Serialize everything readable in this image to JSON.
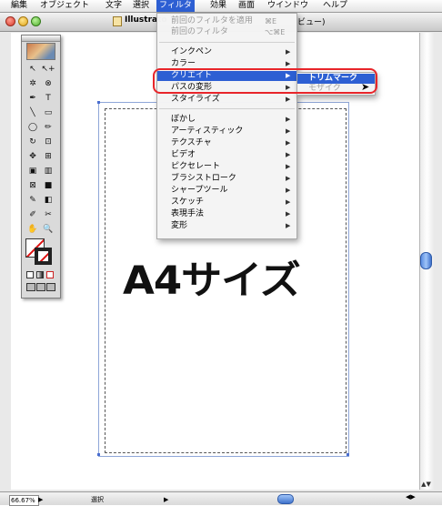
{
  "menubar": {
    "items": [
      "編集",
      "オブジェクト",
      "文字",
      "選択",
      "フィルタ",
      "効果",
      "画面",
      "ウインドウ",
      "ヘルプ"
    ],
    "active": "フィルタ"
  },
  "window": {
    "title": "Illustrato",
    "title_tail": "ビュー)"
  },
  "toolbox": {
    "tools": [
      "↖",
      "↖+",
      "✲",
      "⊗",
      "✒",
      "T",
      "╲",
      "▭",
      "◯",
      "✏",
      "↻",
      "⊡",
      "✥",
      "⊞",
      "▣",
      "▥",
      "⊠",
      "■",
      "✎",
      "◧",
      "✐",
      "✂",
      "✋",
      "🔍"
    ]
  },
  "canvas": {
    "big_text": "A4サイズ"
  },
  "filter_menu": {
    "items": [
      {
        "label": "前回のフィルタを適用",
        "shortcut": "⌘E",
        "disabled": true
      },
      {
        "label": "前回のフィルタ",
        "shortcut": "⌥⌘E",
        "disabled": true
      },
      {
        "label": "インクペン",
        "arrow": "▶"
      },
      {
        "label": "カラー",
        "arrow": "▶"
      },
      {
        "label": "クリエイト",
        "arrow": "▶",
        "highlight": true
      },
      {
        "label": "パスの変形",
        "arrow": "▶"
      },
      {
        "label": "スタイライズ",
        "arrow": "▶"
      },
      {
        "label": "ぼかし",
        "arrow": "▶"
      },
      {
        "label": "アーティスティック",
        "arrow": "▶"
      },
      {
        "label": "テクスチャ",
        "arrow": "▶"
      },
      {
        "label": "ビデオ",
        "arrow": "▶"
      },
      {
        "label": "ピクセレート",
        "arrow": "▶"
      },
      {
        "label": "ブラシストローク",
        "arrow": "▶"
      },
      {
        "label": "シャープツール",
        "arrow": "▶"
      },
      {
        "label": "スケッチ",
        "arrow": "▶"
      },
      {
        "label": "表現手法",
        "arrow": "▶"
      },
      {
        "label": "変形",
        "arrow": "▶"
      }
    ]
  },
  "submenu": {
    "items": [
      {
        "label": "トリムマーク",
        "highlight": true
      },
      {
        "label": "モザイク",
        "disabled": true
      }
    ]
  },
  "statusbar": {
    "zoom": "66.67%",
    "status": "選択",
    "zoom_arrow": "▶",
    "status_arrow": "▶"
  },
  "colors": {
    "accent": "#2d5fd3",
    "callout": "#e8252a"
  }
}
